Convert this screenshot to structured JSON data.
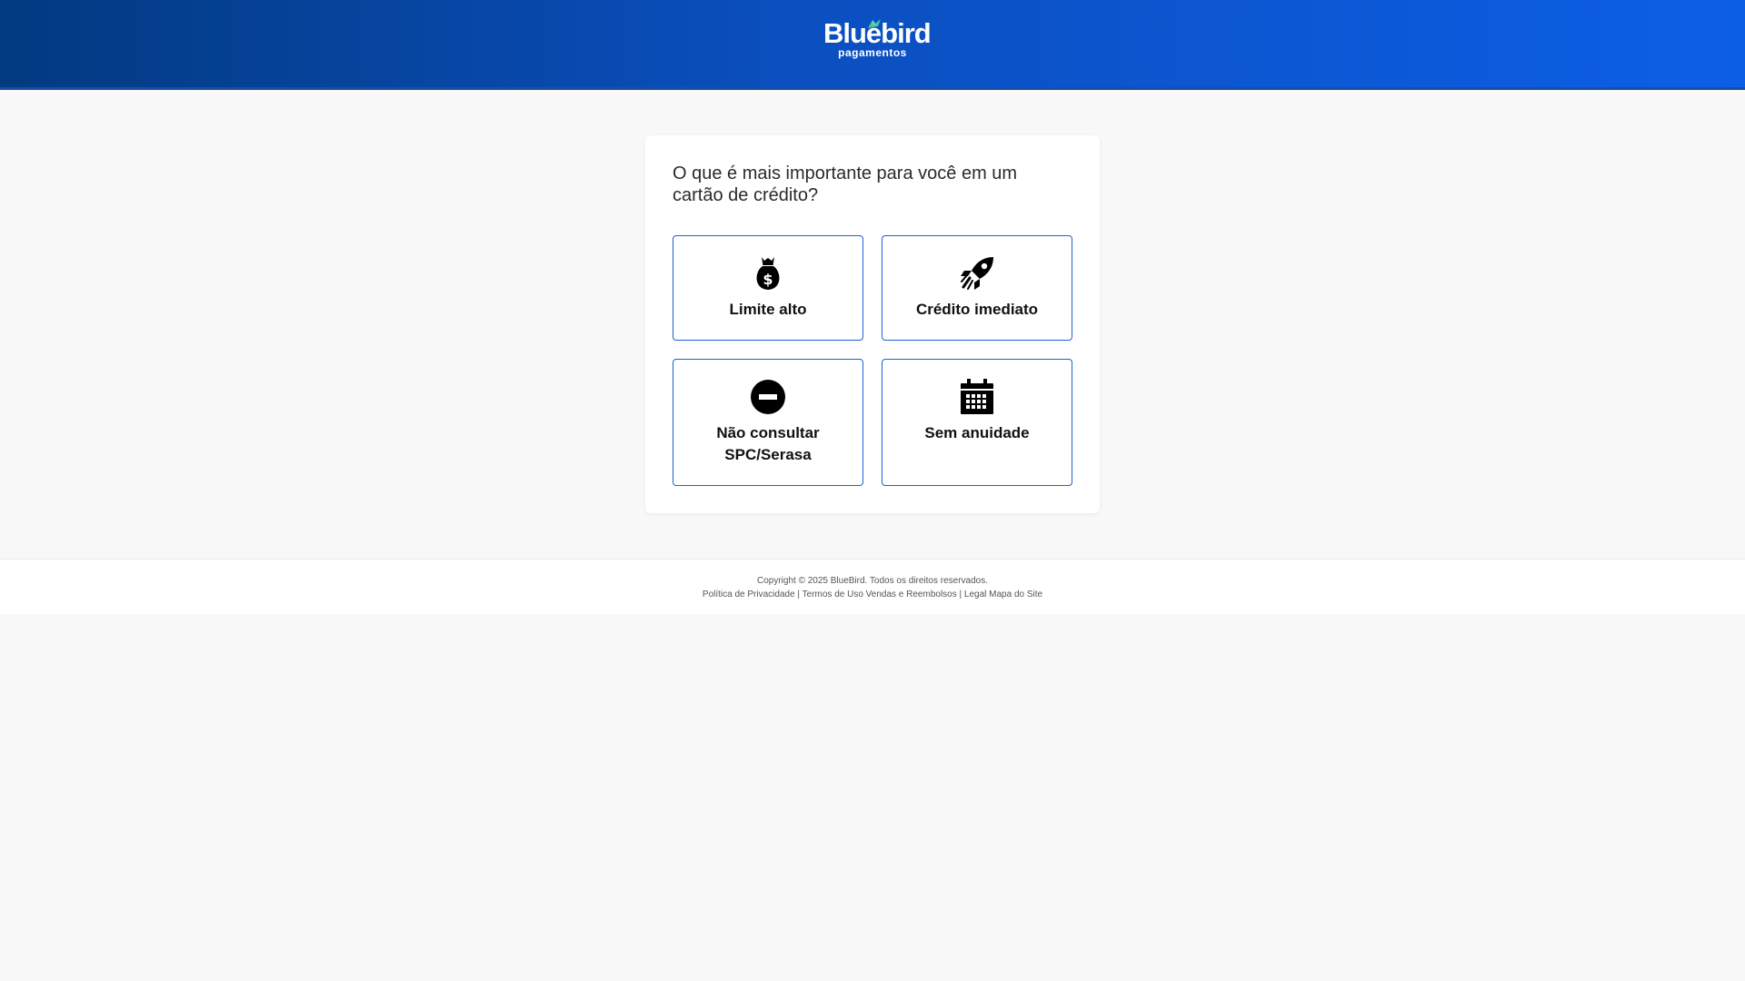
{
  "header": {
    "logo_word": "Bluebird",
    "logo_sub": "pagamentos",
    "bg_color": "#0b4fbf"
  },
  "question": "O que é mais importante para você em um cartão de crédito?",
  "options": [
    {
      "label": "Limite alto",
      "icon": "money-bag-icon"
    },
    {
      "label": "Crédito imediato",
      "icon": "rocket-icon"
    },
    {
      "label": "Não consultar SPC/Serasa",
      "icon": "minus-circle-icon"
    },
    {
      "label": "Sem anuidade",
      "icon": "calendar-icon"
    }
  ],
  "footer": {
    "copyright": "Copyright © 2025 BlueBird. Todos os direitos reservados.",
    "links": [
      "Política de Privacidade",
      "Termos de Uso Vendas e Reembolsos",
      "Legal Mapa do Site"
    ],
    "separator": "|"
  },
  "colors": {
    "accent": "#1f5fd6",
    "page_bg": "#f8f8f8",
    "card_bg": "#ffffff"
  }
}
